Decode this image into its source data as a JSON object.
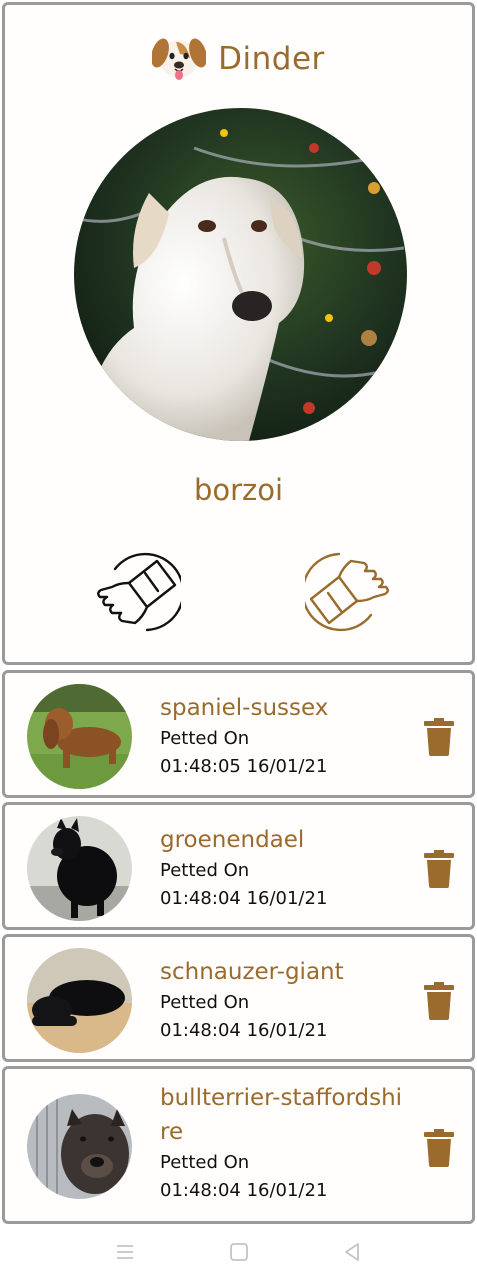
{
  "app": {
    "title": "Dinder",
    "logo_icon": "dog-face-icon"
  },
  "current": {
    "breed": "borzoi",
    "dislike_icon": "thumbs-down-icon",
    "like_icon": "thumbs-up-icon"
  },
  "colors": {
    "accent": "#9a6b2c",
    "card_border": "#9a9a9a",
    "text_dark": "#111111"
  },
  "petted_list": [
    {
      "name": "spaniel-sussex",
      "label": "Petted On",
      "timestamp": "01:48:05 16/01/21"
    },
    {
      "name": "groenendael",
      "label": "Petted On",
      "timestamp": "01:48:04 16/01/21"
    },
    {
      "name": "schnauzer-giant",
      "label": "Petted On",
      "timestamp": "01:48:04 16/01/21"
    },
    {
      "name": "bullterrier-staffordshire",
      "label": "Petted On",
      "timestamp": "01:48:04 16/01/21"
    }
  ],
  "navigation": {
    "menu_icon": "menu-icon",
    "home_icon": "home-icon",
    "back_icon": "back-icon"
  }
}
